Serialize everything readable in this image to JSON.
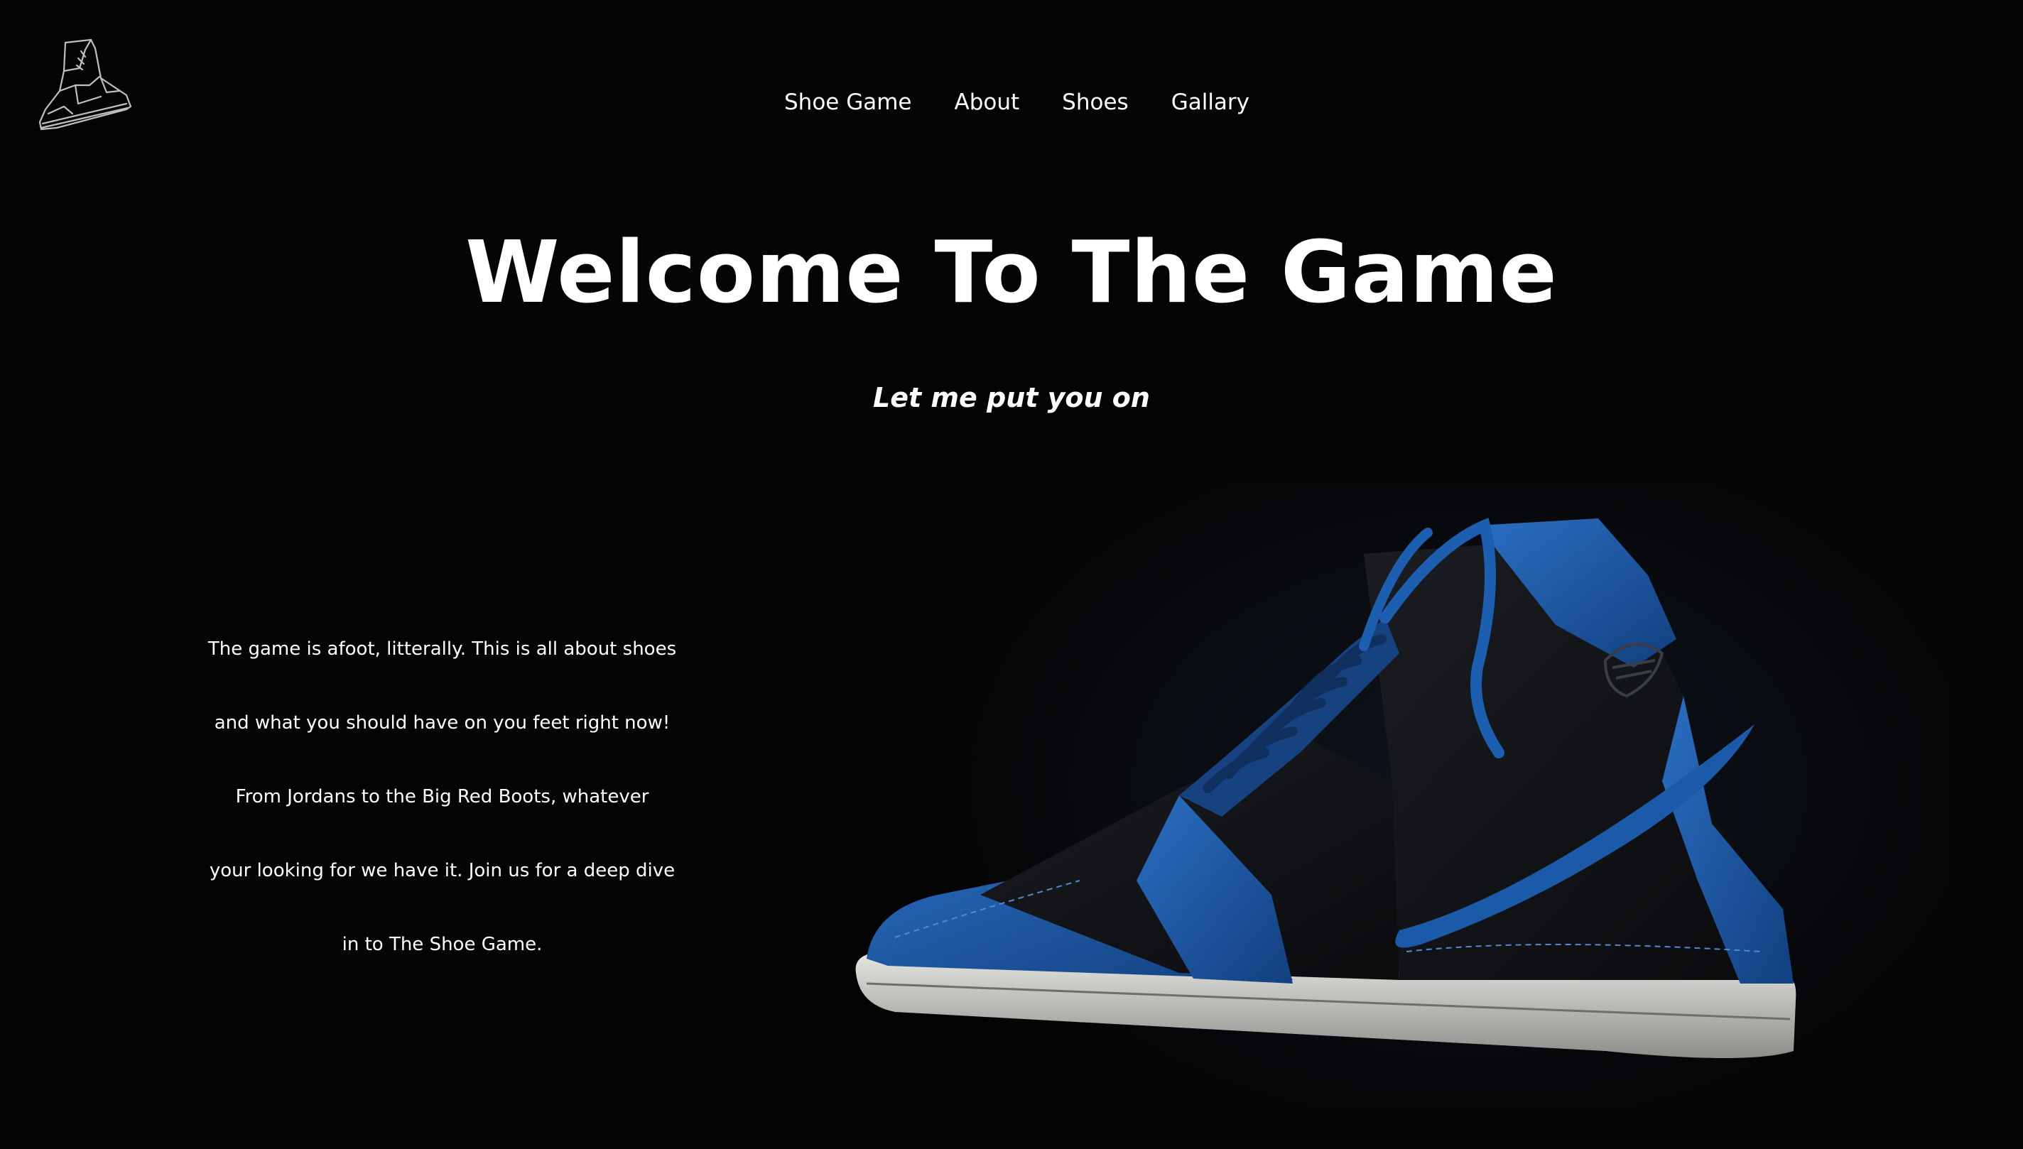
{
  "nav": {
    "items": [
      {
        "label": "Shoe Game"
      },
      {
        "label": "About"
      },
      {
        "label": "Shoes"
      },
      {
        "label": "Gallary"
      }
    ]
  },
  "hero": {
    "title": "Welcome To The Game",
    "subtitle": "Let me put you on"
  },
  "intro": {
    "lines": [
      "The game is afoot, litterally. This is all about shoes",
      "and what you should have on you feet right now!",
      "From Jordans to the Big Red Boots, whatever",
      "your looking for we have it. Join us for a deep dive",
      "in to The Shoe Game."
    ]
  },
  "icons": {
    "logo": "sneaker-outline-icon"
  },
  "colors": {
    "background": "#040405",
    "text": "#ffffff",
    "shoe_blue": "#1a5aa8",
    "shoe_black": "#121417",
    "sole_white": "#d9d9d6"
  }
}
